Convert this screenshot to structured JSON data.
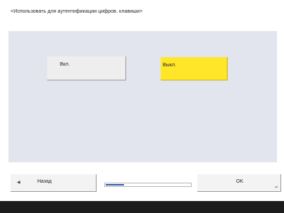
{
  "screen": {
    "title": "<Использовать для аутентификации цифров. клавиши>"
  },
  "options": {
    "on_label": "Вкл.",
    "off_label": "Выкл.",
    "selected": "off"
  },
  "footer": {
    "back_label": "Назад",
    "back_icon": "triangle-left",
    "ok_label": "OK",
    "ok_icon": "return-arrow",
    "progress_fraction": 0.22
  },
  "colors": {
    "selected_option": "#ffe628",
    "progress_fill": "#2a56b0"
  }
}
